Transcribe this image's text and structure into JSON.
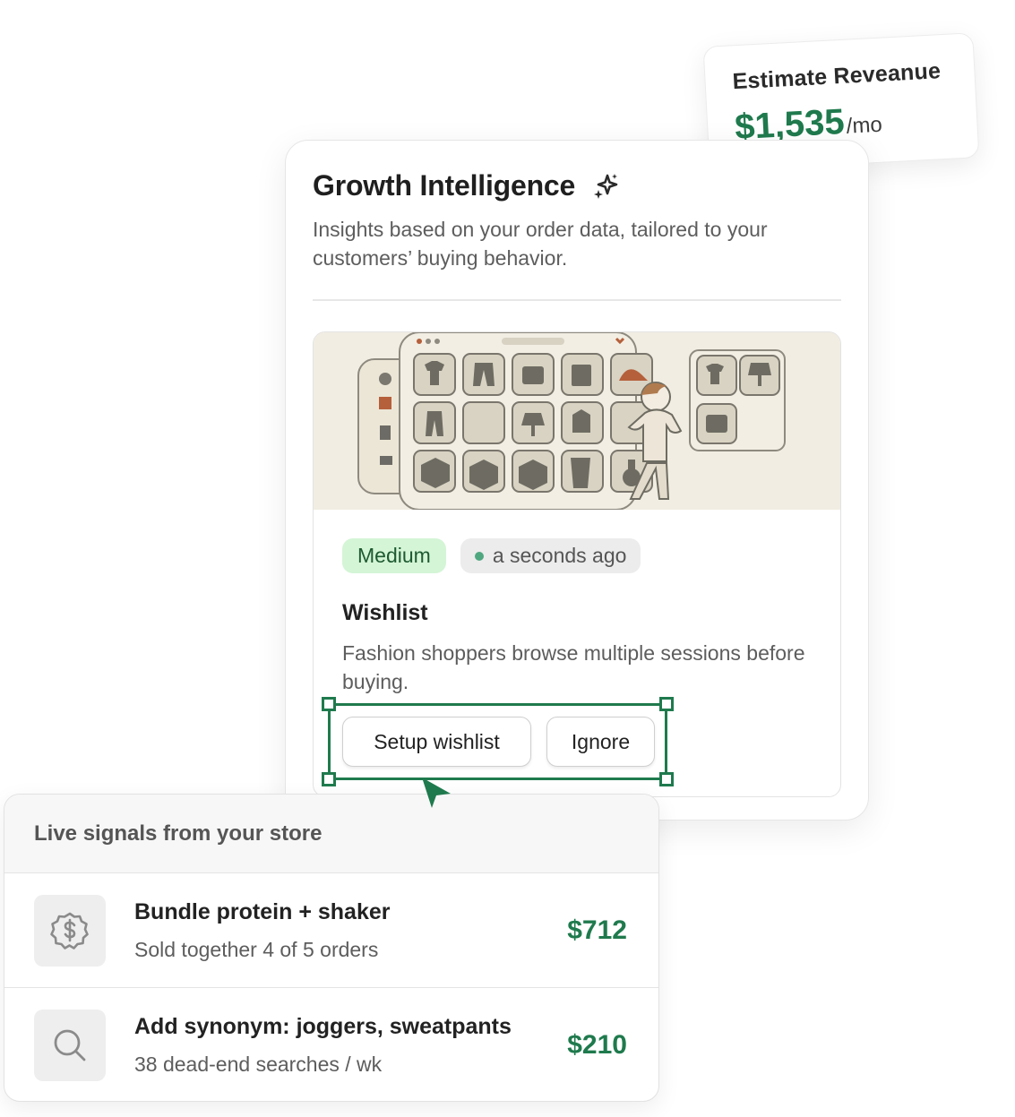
{
  "revenue_card": {
    "title": "Estimate Reveanue",
    "amount": "$1,535",
    "unit": "/mo"
  },
  "growth_card": {
    "title": "Growth Intelligence",
    "title_icon": "sparkle-icon",
    "subtitle": "Insights based on your order data, tailored to your customers’ buying behavior.",
    "insight": {
      "illustration": "wishlist-illustration",
      "priority_badge": "Medium",
      "time_badge": "a seconds ago",
      "title": "Wishlist",
      "description": "Fashion shoppers browse multiple sessions before buying.",
      "primary_button": "Setup wishlist",
      "secondary_button": "Ignore"
    }
  },
  "signals_card": {
    "header": "Live signals from your store",
    "items": [
      {
        "icon": "dollar-badge-icon",
        "title": "Bundle protein + shaker",
        "subtitle": "Sold together 4 of 5 orders",
        "value": "$712"
      },
      {
        "icon": "search-icon",
        "title": "Add synonym: joggers, sweatpants",
        "subtitle": "38 dead-end searches / wk",
        "value": "$210"
      }
    ]
  },
  "colors": {
    "accent_green": "#1f7a4d",
    "badge_green_bg": "#d4f5d6",
    "illustration_bg": "#f1ede2"
  }
}
